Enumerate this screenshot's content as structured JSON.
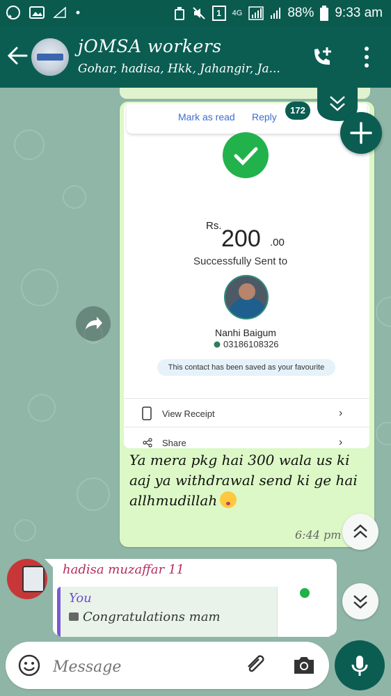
{
  "status_bar": {
    "battery": "88%",
    "time": "9:33 am",
    "network": "4G",
    "sim_badge": "1"
  },
  "header": {
    "title": "jOMSA workers",
    "subtitle": "Gohar, hadisa, Hkk, Jahangir, Ja..."
  },
  "payment_receipt": {
    "actions": {
      "mark_as_read": "Mark as read",
      "reply": "Reply"
    },
    "unread_count": "172",
    "currency": "Rs.",
    "amount": "200",
    "decimals": ".00",
    "status_text": "Successfully Sent to",
    "recipient_name": "Nanhi Baigum",
    "recipient_phone": "03186108326",
    "favourite_note": "This contact has been saved as your favourite",
    "view_receipt": "View Receipt",
    "share": "Share"
  },
  "outgoing_message": {
    "text": "Ya mera pkg hai 300 wala us ki aaj ya withdrawal send ki ge hai allhmudillah",
    "time": "6:44 pm"
  },
  "incoming_message": {
    "sender": "hadisa muzaffar 11",
    "quote_author": "You",
    "quote_text": "Congratulations mam"
  },
  "composer": {
    "placeholder": "Message"
  },
  "colors": {
    "header": "#0b5d52",
    "outgoing_bubble": "#dcf8c6",
    "accent_blue": "#3b6ed0",
    "success_green": "#22b24c",
    "sender_name": "#b52b5e"
  },
  "icons": {
    "back": "arrow-left-icon",
    "call": "call-add-icon",
    "menu": "kebab-menu-icon",
    "fab": "plus-icon",
    "scroll_up": "chevron-double-up-icon",
    "scroll_down": "chevron-double-down-icon",
    "forward": "forward-icon",
    "emoji": "emoji-icon",
    "attach": "paperclip-icon",
    "camera": "camera-icon",
    "mic": "mic-icon"
  }
}
